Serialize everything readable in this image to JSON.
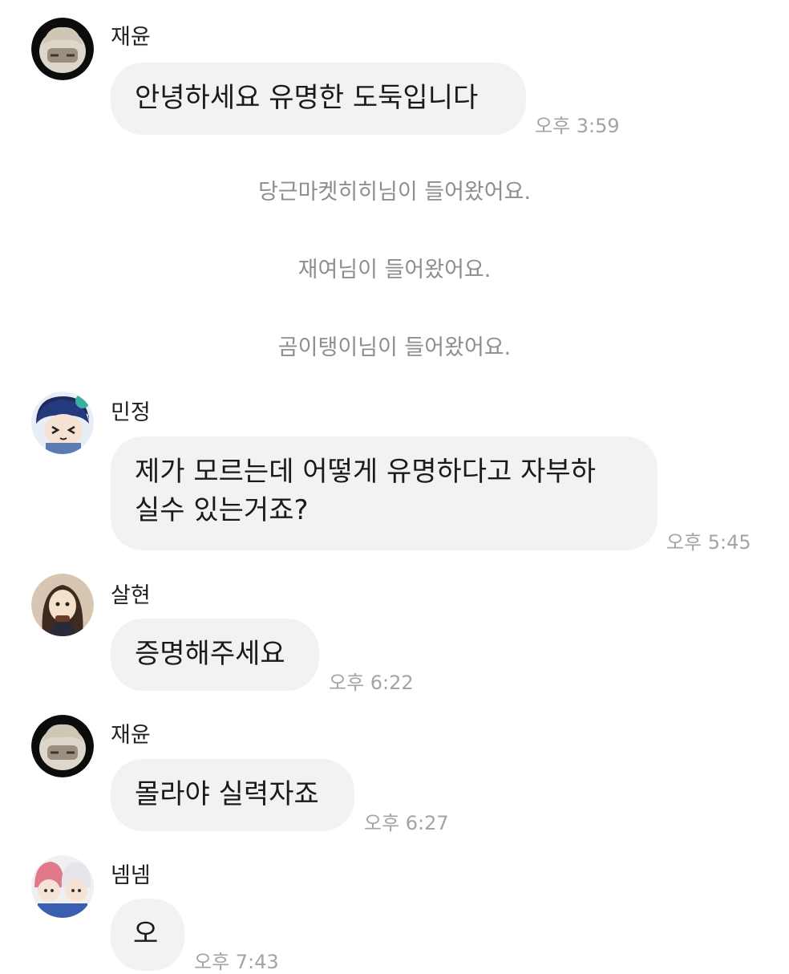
{
  "messages": [
    {
      "sender": "재윤",
      "text": "안녕하세요 유명한 도둑입니다",
      "time": "오후 3:59"
    },
    {
      "sender": "민정",
      "text_line1": "제가 모르는데 어떻게 유명하다고 자부하",
      "text_line2": "실수 있는거죠?",
      "time": "오후 5:45"
    },
    {
      "sender": "살현",
      "text": "증명해주세요",
      "time": "오후 6:22"
    },
    {
      "sender": "재윤",
      "text": "몰라야 실력자죠",
      "time": "오후 6:27"
    },
    {
      "sender": "넴넴",
      "text": "오",
      "time": "오후 7:43"
    }
  ],
  "system_notices": [
    "당근마켓히히님이 들어왔어요.",
    "재여님이 들어왔어요.",
    "곰이탱이님이 들어왔어요."
  ],
  "colors": {
    "bubble_bg": "#f2f2f5",
    "time_text": "#a3a3a8",
    "system_text": "#8d8d92"
  }
}
